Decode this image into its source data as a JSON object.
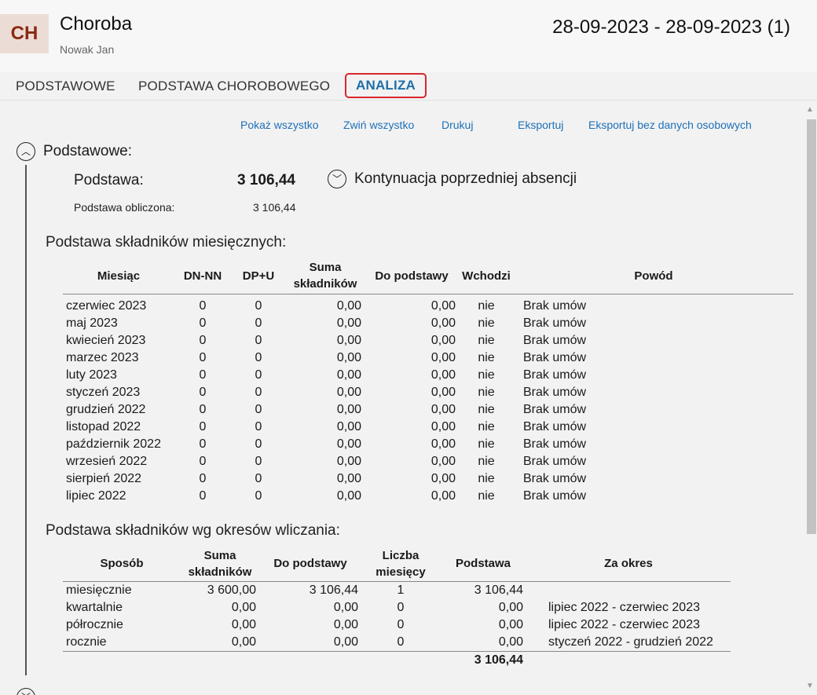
{
  "header": {
    "avatar": "CH",
    "title": "Choroba",
    "subtitle": "Nowak Jan",
    "daterange": "28-09-2023 - 28-09-2023 (1)"
  },
  "tabs": [
    "PODSTAWOWE",
    "PODSTAWA CHOROBOWEGO",
    "ANALIZA"
  ],
  "toolbar": [
    "Pokaż wszystko",
    "Zwiń wszystko",
    "Drukuj",
    "Eksportuj",
    "Eksportuj bez danych osobowych"
  ],
  "section": {
    "title": "Podstawowe:",
    "podstawa_label": "Podstawa:",
    "podstawa_value": "3 106,44",
    "obliczona_label": "Podstawa obliczona:",
    "obliczona_value": "3 106,44",
    "kontynuacja": "Kontynuacja poprzedniej absencji"
  },
  "monthly": {
    "heading": "Podstawa składników miesięcznych:",
    "headers": [
      "Miesiąc",
      "DN-NN",
      "DP+U",
      "Suma składników",
      "Do podstawy",
      "Wchodzi",
      "Powód"
    ],
    "rows": [
      [
        "czerwiec 2023",
        "0",
        "0",
        "0,00",
        "0,00",
        "nie",
        "Brak umów"
      ],
      [
        "maj 2023",
        "0",
        "0",
        "0,00",
        "0,00",
        "nie",
        "Brak umów"
      ],
      [
        "kwiecień 2023",
        "0",
        "0",
        "0,00",
        "0,00",
        "nie",
        "Brak umów"
      ],
      [
        "marzec 2023",
        "0",
        "0",
        "0,00",
        "0,00",
        "nie",
        "Brak umów"
      ],
      [
        "luty 2023",
        "0",
        "0",
        "0,00",
        "0,00",
        "nie",
        "Brak umów"
      ],
      [
        "styczeń 2023",
        "0",
        "0",
        "0,00",
        "0,00",
        "nie",
        "Brak umów"
      ],
      [
        "grudzień 2022",
        "0",
        "0",
        "0,00",
        "0,00",
        "nie",
        "Brak umów"
      ],
      [
        "listopad 2022",
        "0",
        "0",
        "0,00",
        "0,00",
        "nie",
        "Brak umów"
      ],
      [
        "październik 2022",
        "0",
        "0",
        "0,00",
        "0,00",
        "nie",
        "Brak umów"
      ],
      [
        "wrzesień 2022",
        "0",
        "0",
        "0,00",
        "0,00",
        "nie",
        "Brak umów"
      ],
      [
        "sierpień 2022",
        "0",
        "0",
        "0,00",
        "0,00",
        "nie",
        "Brak umów"
      ],
      [
        "lipiec 2022",
        "0",
        "0",
        "0,00",
        "0,00",
        "nie",
        "Brak umów"
      ]
    ]
  },
  "periods": {
    "heading": "Podstawa składników wg okresów wliczania:",
    "headers": [
      "Sposób",
      "Suma składników",
      "Do podstawy",
      "Liczba miesięcy",
      "Podstawa",
      "Za okres"
    ],
    "rows": [
      [
        "miesięcznie",
        "3 600,00",
        "3 106,44",
        "1",
        "3 106,44",
        ""
      ],
      [
        "kwartalnie",
        "0,00",
        "0,00",
        "0",
        "0,00",
        "lipiec 2022 - czerwiec 2023"
      ],
      [
        "półrocznie",
        "0,00",
        "0,00",
        "0",
        "0,00",
        "lipiec 2022 - czerwiec 2023"
      ],
      [
        "rocznie",
        "0,00",
        "0,00",
        "0",
        "0,00",
        "styczeń 2022 - grudzień 2022"
      ]
    ],
    "total": "3 106,44"
  }
}
